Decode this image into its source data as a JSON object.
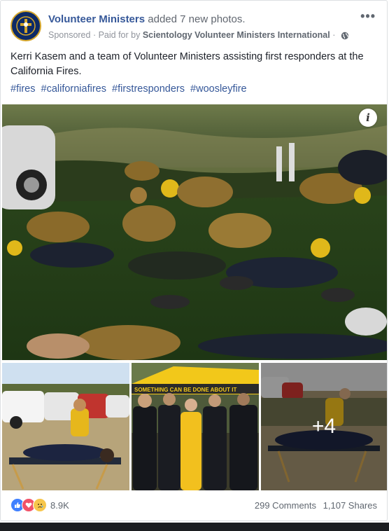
{
  "post": {
    "page_name": "Volunteer Ministers",
    "action": "added",
    "photo_count_text": "7 new photos.",
    "sponsored_label": "Sponsored",
    "paid_for_prefix": "Paid for by",
    "payer": "Scientology Volunteer Ministers International",
    "more_label": "•••",
    "body": "Kerri Kasem and a team of Volunteer Ministers assisting first responders at the California Fires.",
    "hashtags": [
      "#fires",
      "#californiafires",
      "#firstresponders",
      "#woosleyfire"
    ]
  },
  "photos": {
    "info_label": "i",
    "banner_text": "SOMETHING CAN BE DONE ABOUT IT",
    "more_photos_label": "+4"
  },
  "footer": {
    "reaction_icons": [
      "like-icon",
      "love-icon",
      "sad-icon"
    ],
    "reaction_count": "8.9K",
    "comments": "299 Comments",
    "shares": "1,107 Shares"
  },
  "colors": {
    "link": "#365899",
    "meta": "#90949c",
    "like": "#4080ff",
    "love": "#f25268",
    "sad": "#f7c64b"
  }
}
